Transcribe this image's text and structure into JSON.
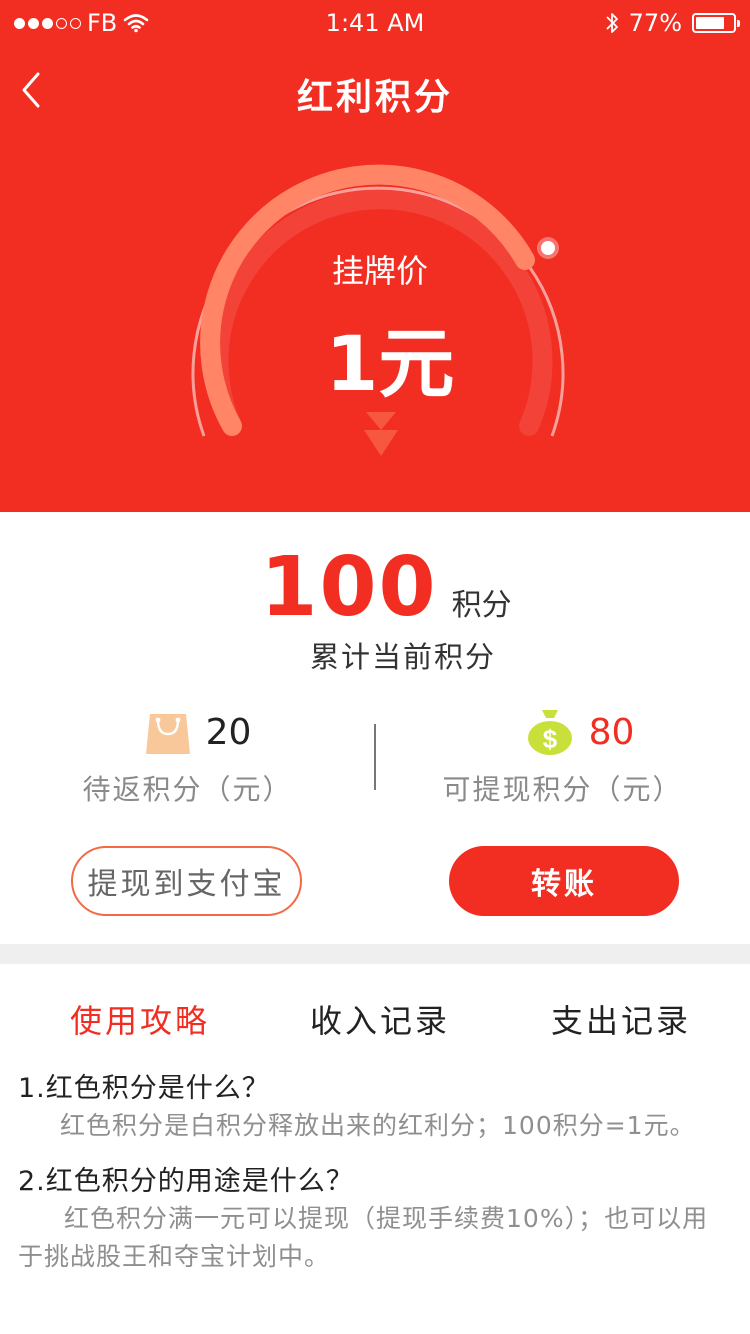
{
  "status_bar": {
    "carrier": "FB",
    "time": "1:41 AM",
    "battery": "77%",
    "battery_level": 0.77
  },
  "nav": {
    "title": "红利积分"
  },
  "gauge": {
    "label": "挂牌价",
    "value": "1元"
  },
  "points": {
    "value": "100",
    "unit": "积分",
    "caption": "累计当前积分"
  },
  "pending": {
    "value": "20",
    "label": "待返积分（元）",
    "icon": "shopping-bag-icon"
  },
  "withdrawable": {
    "value": "80",
    "label": "可提现积分（元）",
    "icon": "money-bag-icon"
  },
  "buttons": {
    "withdraw": "提现到支付宝",
    "transfer": "转账"
  },
  "tabs": [
    {
      "label": "使用攻略",
      "active": true
    },
    {
      "label": "收入记录",
      "active": false
    },
    {
      "label": "支出记录",
      "active": false
    }
  ],
  "faq": [
    {
      "question": "1.红色积分是什么？",
      "answer": "红色积分是白积分释放出来的红利分；100积分=1元。"
    },
    {
      "question": "2.红色积分的用途是什么？",
      "answer": "红色积分满一元可以提现（提现手续费10%）；也可以用于挑战股王和夺宝计划中。"
    }
  ],
  "colors": {
    "primary": "#f22d22",
    "outline": "#f36a44",
    "bag": "#f8c89a",
    "money": "#c9e03a"
  }
}
